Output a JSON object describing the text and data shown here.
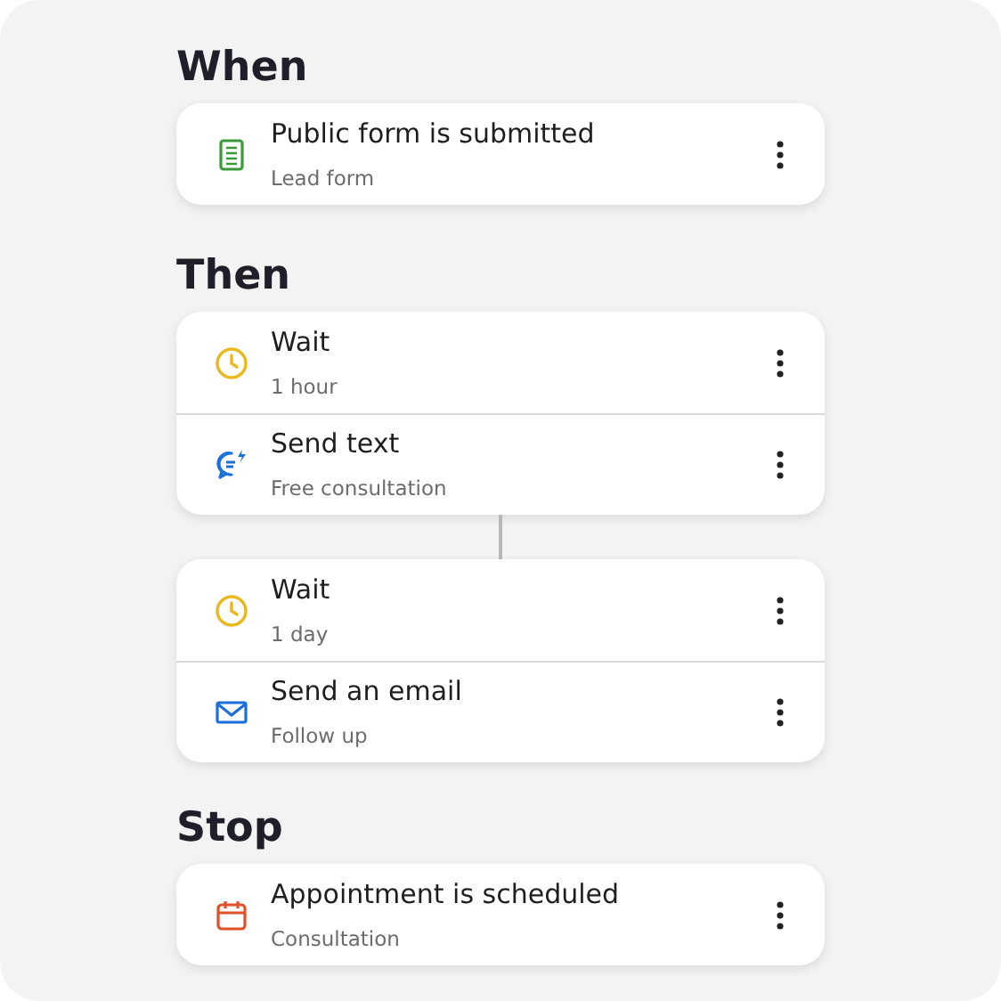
{
  "sections": [
    {
      "title": "When",
      "groups": [
        [
          {
            "kind": "form",
            "title": "Public form is submitted",
            "subtitle": "Lead form"
          }
        ]
      ]
    },
    {
      "title": "Then",
      "groups": [
        [
          {
            "kind": "clock",
            "title": "Wait",
            "subtitle": "1 hour"
          },
          {
            "kind": "chat",
            "title": "Send text",
            "subtitle": "Free consultation"
          }
        ],
        [
          {
            "kind": "clock",
            "title": "Wait",
            "subtitle": "1 day"
          },
          {
            "kind": "mail",
            "title": "Send an email",
            "subtitle": "Follow up"
          }
        ]
      ]
    },
    {
      "title": "Stop",
      "groups": [
        [
          {
            "kind": "calendar",
            "title": "Appointment is scheduled",
            "subtitle": "Consultation"
          }
        ]
      ]
    }
  ]
}
